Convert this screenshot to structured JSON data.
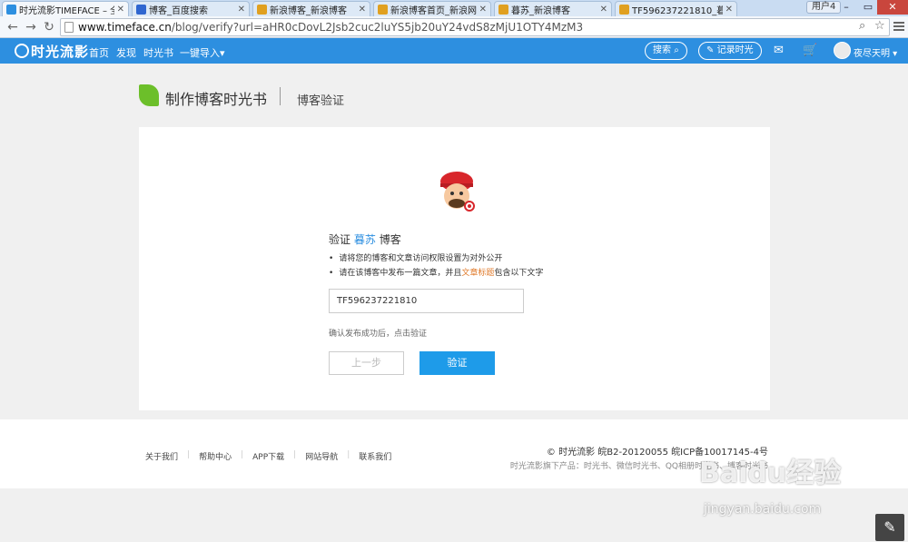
{
  "browser": {
    "tabs": [
      {
        "title": "时光流影TIMEFACE – 全",
        "favicon_color": "#2d8fe0"
      },
      {
        "title": "博客_百度搜索",
        "favicon_color": "#2f66d0"
      },
      {
        "title": "新浪博客_新浪博客",
        "favicon_color": "#e0a020"
      },
      {
        "title": "新浪博客首页_新浪网",
        "favicon_color": "#e0a020"
      },
      {
        "title": "暮苏_新浪博客",
        "favicon_color": "#e0a020"
      },
      {
        "title": "TF596237221810_暮苏_",
        "favicon_color": "#e0a020"
      }
    ],
    "user_label": "用户4",
    "url_host": "www.timeface.cn",
    "url_path": "/blog/verify?url=aHR0cDovL2Jsb2cuc2luYS5jb20uY24vdS8zMjU1OTY4MzM3"
  },
  "header": {
    "logo": "时光流影",
    "nav": [
      "首页",
      "发现",
      "时光书",
      "一键导入▾"
    ],
    "search_label": "搜索",
    "record_label": "记录时光",
    "username": "夜尽天明 ▾"
  },
  "page": {
    "title": "制作博客时光书",
    "subtitle": "博客验证"
  },
  "verify": {
    "prefix": "验证",
    "blog_name": "暮苏",
    "suffix": "博客",
    "tip1": "请将您的博客和文章访问权限设置为对外公开",
    "tip2_pre": "请在该博客中发布一篇文章，并且",
    "tip2_highlight": "文章标题",
    "tip2_post": "包含以下文字",
    "code": "TF596237221810",
    "confirm_text": "确认发布成功后，点击验证",
    "prev_label": "上一步",
    "verify_label": "验证"
  },
  "footer": {
    "links": [
      "关于我们",
      "帮助中心",
      "APP下载",
      "网站导航",
      "联系我们"
    ],
    "copyright": "© 时光流影 皖B2-20120055 皖ICP备10017145-4号",
    "products": "时光流影旗下产品：时光书、微信时光书、QQ相册时光书、博客时光书"
  },
  "watermark": {
    "line1": "Baidu经验",
    "line2": "jingyan.baidu.com"
  },
  "colors": {
    "brand_blue": "#2d8fe0",
    "button_blue": "#1e9be9",
    "highlight_orange": "#e07a2a",
    "leaf_green": "#6cbf2a"
  }
}
